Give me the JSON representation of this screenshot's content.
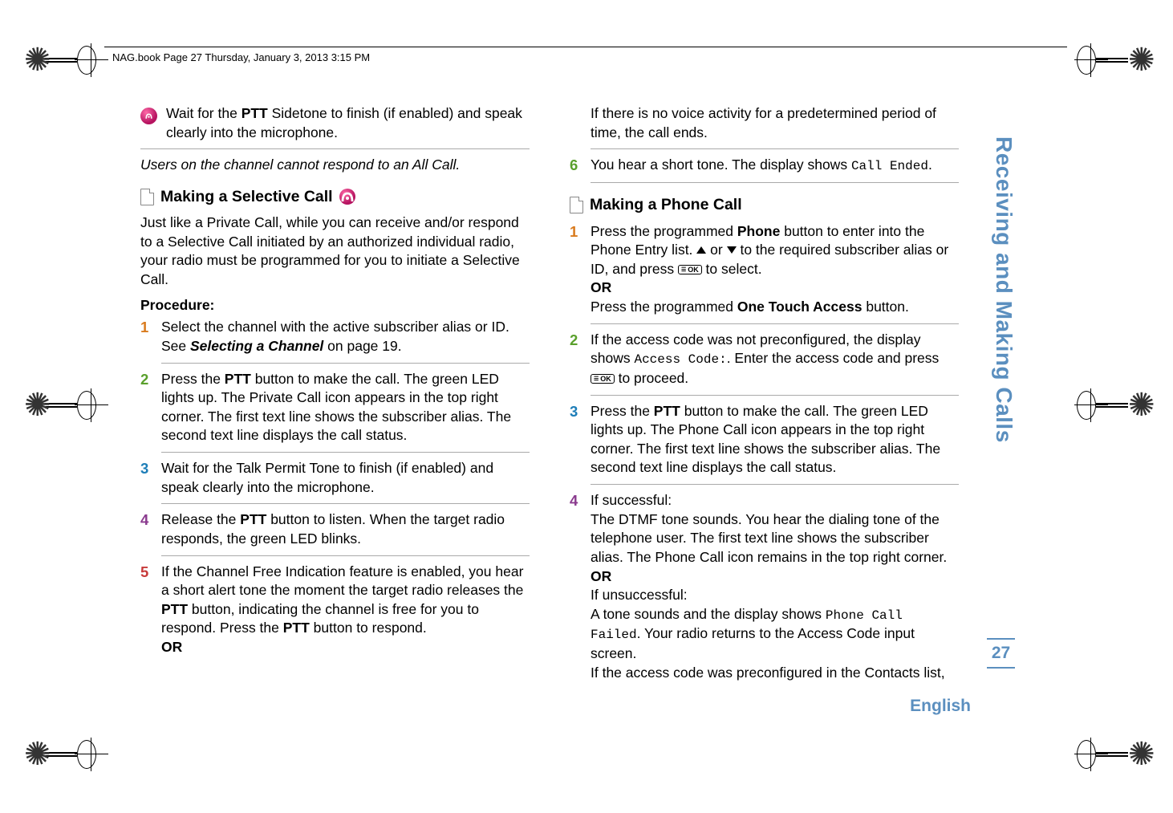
{
  "header": "NAG.book  Page 27  Thursday, January 3, 2013  3:15 PM",
  "col1": {
    "intro_icon_text": "Wait for the ",
    "intro_ptt": "PTT",
    "intro_rest": " Sidetone to finish (if enabled) and speak clearly into the microphone.",
    "note": "Users on the channel cannot respond to an All Call.",
    "heading": "Making a Selective Call",
    "desc": "Just like a Private Call, while you can receive and/or respond to a Selective Call initiated by an authorized individual radio, your radio must be programmed for you to initiate a Selective Call.",
    "procedure": "Procedure:",
    "s1a": "Select the channel with the active subscriber alias or ID. See ",
    "s1b": "Selecting a Channel",
    "s1c": " on page 19.",
    "s2a": "Press the ",
    "s2b": "PTT",
    "s2c": " button to make the call. The green LED lights up. The Private Call icon appears in the top right corner. The first text line shows the subscriber alias. The second text line displays the call status.",
    "s3": "Wait for the Talk Permit Tone to finish (if enabled) and speak clearly into the microphone.",
    "s4a": "Release the ",
    "s4b": "PTT",
    "s4c": " button to listen. When the target radio responds, the green LED blinks.",
    "s5a": "If the Channel Free Indication feature is enabled, you hear a short alert tone the moment the target radio releases the ",
    "s5b": "PTT",
    "s5c": " button, indicating the channel is free for you to respond. Press the ",
    "s5d": "PTT",
    "s5e": " button to respond.",
    "s5or": "OR"
  },
  "col2": {
    "top": "If there is no voice activity for a predetermined period of time, the call ends.",
    "s6a": "You hear a short tone. The display shows ",
    "s6b": "Call Ended",
    "s6c": ".",
    "heading": "Making a Phone Call",
    "s1a": "Press the programmed ",
    "s1b": "Phone",
    "s1c": " button to enter into the Phone Entry list. ",
    "s1d": " or ",
    "s1e": " to the required subscriber alias or ID, and press ",
    "s1f": " to select.",
    "s1or": "OR",
    "s1g": "Press the programmed ",
    "s1h": "One Touch Access",
    "s1i": " button.",
    "s2a": "If the access code was not preconfigured, the display shows ",
    "s2b": "Access Code:",
    "s2c": ". Enter the access code and press ",
    "s2d": " to proceed.",
    "s3a": "Press the ",
    "s3b": "PTT",
    "s3c": " button to make the call. The green LED lights up. The Phone Call icon appears in the top right corner. The first text line shows the subscriber alias. The second text line displays the call status.",
    "s4a": "If successful:",
    "s4b": "The DTMF tone sounds. You hear the dialing tone of the telephone user. The first text line shows the subscriber alias. The Phone Call icon remains in the top right corner.",
    "s4or": "OR",
    "s4c": "If unsuccessful:",
    "s4d": "A tone sounds and the display shows ",
    "s4e": "Phone Call Failed",
    "s4f": ". Your radio returns to the Access Code input screen.",
    "s4g": "If the access code was preconfigured in the Contacts list,"
  },
  "side": "Receiving and Making Calls",
  "page": "27",
  "lang": "English"
}
